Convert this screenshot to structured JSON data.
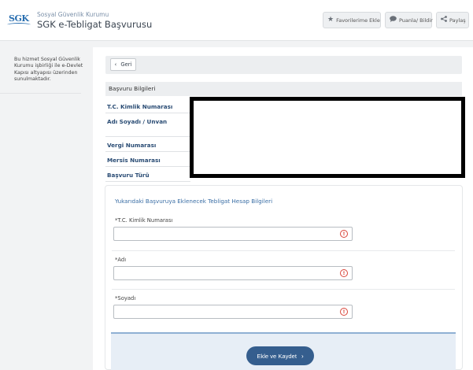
{
  "header": {
    "logo_text": "SGK",
    "org_name": "Sosyal Güvenlik Kurumu",
    "service_name": "SGK e-Tebligat Başvurusu",
    "buttons": {
      "favorite": "Favorilerime Ekle",
      "rate": "Puanla/ Bildir",
      "share": "Paylaş"
    },
    "icons": {
      "favorite": "star-icon",
      "rate": "comment-icon",
      "share": "share-icon"
    }
  },
  "sidebar": {
    "note": "Bu hizmet Sosyal Güvenlik Kurumu işbirliği ile e-Devlet Kapısı altyapısı üzerinden sunulmaktadır."
  },
  "main": {
    "back_label": "Geri",
    "section_title": "Başvuru Bilgileri",
    "info_labels": {
      "tc": "T.C. Kimlik Numarası",
      "name": "Adı Soyadı / Unvan",
      "tax": "Vergi Numarası",
      "mersis": "Mersis Numarası",
      "type": "Başvuru Türü"
    }
  },
  "form": {
    "title": "Yukarıdaki Başvuruya Eklenecek Tebligat Hesap Bilgileri",
    "fields": {
      "tc": {
        "label": "*T.C. Kimlik Numarası",
        "value": ""
      },
      "first_name": {
        "label": "*Adı",
        "value": ""
      },
      "last_name": {
        "label": "*Soyadı",
        "value": ""
      }
    },
    "submit_label": "Ekle ve Kaydet"
  },
  "colors": {
    "accent": "#355e8e",
    "label_blue": "#2a4c74",
    "warning": "#d9453a"
  }
}
